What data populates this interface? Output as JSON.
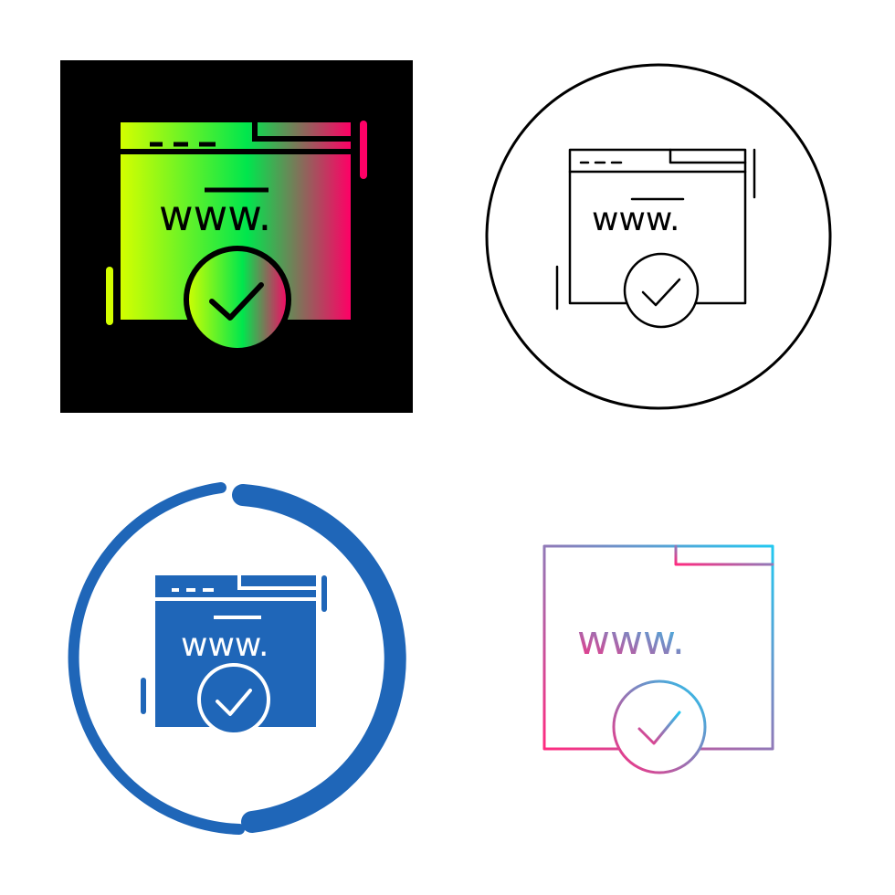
{
  "icon_set": [
    {
      "style": "glyph-gradient",
      "icon": "www-verified-browser-icon",
      "url_text": "www.",
      "colors": {
        "background": "#000000",
        "gradient_start": "#d4ff00",
        "gradient_mid": "#00e64d",
        "gradient_end": "#ff0066"
      }
    },
    {
      "style": "line",
      "icon": "www-verified-browser-icon",
      "url_text": "www.",
      "colors": {
        "stroke": "#000000",
        "background": "#ffffff"
      }
    },
    {
      "style": "solid-circular",
      "icon": "www-verified-browser-icon",
      "url_text": "www.",
      "colors": {
        "fill": "#1f66b8",
        "detail": "#ffffff"
      }
    },
    {
      "style": "gradient-line",
      "icon": "www-verified-browser-icon",
      "url_text": "www.",
      "colors": {
        "gradient_start": "#ff2a7f",
        "gradient_end": "#22c8f0"
      }
    }
  ]
}
